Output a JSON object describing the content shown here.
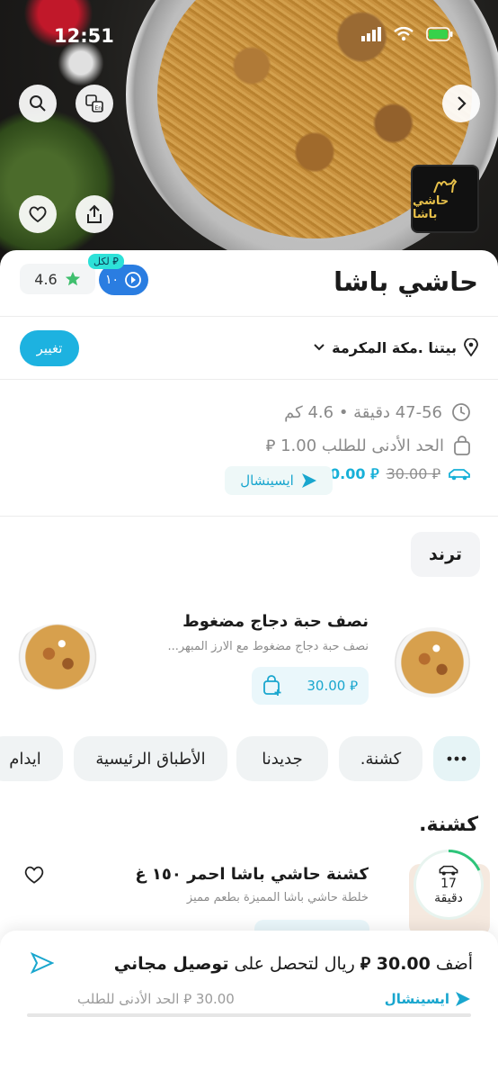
{
  "status_bar": {
    "time": "12:51"
  },
  "hero": {
    "logo_text": "حاشي باشا"
  },
  "header": {
    "title": "حاشي باشا",
    "rating": "4.6",
    "promo_value": "١٠",
    "promo_tag": "لكل ⃁"
  },
  "location": {
    "text": "بيتنا .مكة المكرمة",
    "change_label": "تغيير"
  },
  "info": {
    "delivery_time": "47-56 دقيقة • 4.6 كم",
    "min_order": "الحد الأدنى للطلب 1.00 ⃁",
    "fee_new": "⃁ 0.00",
    "fee_old": "⃁ 30.00",
    "special_label": "ايسينشال"
  },
  "trend": {
    "label": "ترند"
  },
  "featured_item": {
    "name": "نصف حبة دجاج مضغوط",
    "desc": "نصف حبة دجاج مضغوط مع الارز المبهر...",
    "price": "⃁ 30.00"
  },
  "categories": [
    ".كشنة",
    "جديدنا",
    "الأطباق الرئيسية",
    "ايدام"
  ],
  "section": {
    "title": ".كشنة",
    "item_name": "كشنة حاشي باشا احمر ١٥٠ غ",
    "item_desc": "خلطة حاشي باشا المميزة بطعم مميز",
    "timer_value": "17",
    "timer_unit": "دقيقة"
  },
  "bottom_bar": {
    "prefix": "أضف",
    "amount": "30.00 ⃁",
    "middle": "ريال لتحصل على",
    "bold_end": "توصيل مجاني",
    "min_order": "30.00 ⃁ الحد الأدنى للطلب",
    "special_label": "ايسينشال",
    "progress": 0
  },
  "colors": {
    "accent": "#1db2e0",
    "promo_blue": "#2a7de1",
    "green": "#2ec47a"
  }
}
